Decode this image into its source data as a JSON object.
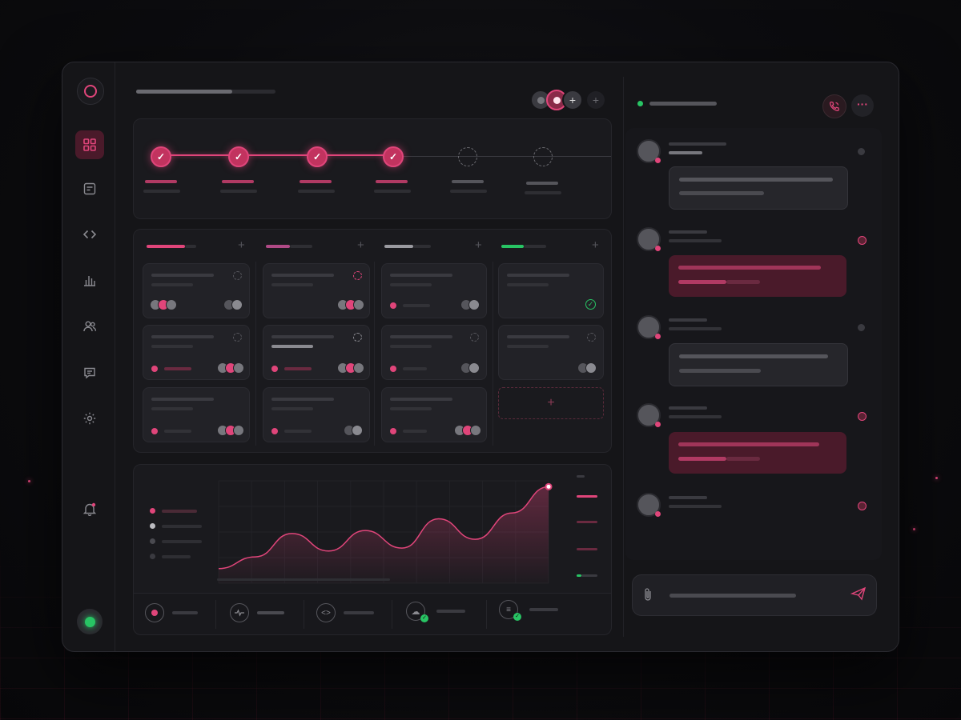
{
  "colors": {
    "accent": "#e0457a",
    "accent_dark": "#c2335f",
    "success": "#28c464",
    "panel": "#1a1a1e"
  },
  "sidebar": {
    "items": [
      {
        "icon": "grid-icon",
        "active": true
      },
      {
        "icon": "checklist-icon",
        "active": false
      },
      {
        "icon": "code-icon",
        "active": false
      },
      {
        "icon": "bar-chart-icon",
        "active": false
      },
      {
        "icon": "users-icon",
        "active": false
      },
      {
        "icon": "chat-icon",
        "active": false
      },
      {
        "icon": "gear-icon",
        "active": false
      }
    ],
    "notifications_icon": "bell-icon",
    "status": "online"
  },
  "header": {
    "add_icon": "plus-icon"
  },
  "progress": {
    "steps_total": 6,
    "steps_done": 4
  },
  "board": {
    "columns": [
      {
        "color": "#e0457a",
        "cards": 3
      },
      {
        "color": "#b04a86",
        "cards": 3
      },
      {
        "color": "#9a9aa0",
        "cards": 3
      },
      {
        "color": "#28c464",
        "cards": 2,
        "has_add_card": true
      }
    ],
    "add_card_label": "+"
  },
  "chart_data": {
    "type": "area",
    "series": [
      {
        "values": [
          10,
          18,
          34,
          22,
          36,
          24,
          44,
          30,
          48,
          66
        ]
      }
    ],
    "ylim": [
      0,
      70
    ],
    "grid": true,
    "legend": "left"
  },
  "footer_stats": [
    {
      "icon": "record-icon"
    },
    {
      "icon": "pulse-icon"
    },
    {
      "icon": "code-icon"
    },
    {
      "icon": "cloud-check-icon"
    },
    {
      "icon": "list-check-icon"
    }
  ],
  "chat": {
    "status": "online",
    "header_icons": [
      "phone-icon",
      "more-icon"
    ],
    "messages": [
      {
        "style": "neutral"
      },
      {
        "style": "accent"
      },
      {
        "style": "neutral"
      },
      {
        "style": "accent"
      },
      {
        "style": "none"
      }
    ],
    "attach_icon": "paperclip-icon",
    "send_icon": "send-icon"
  }
}
